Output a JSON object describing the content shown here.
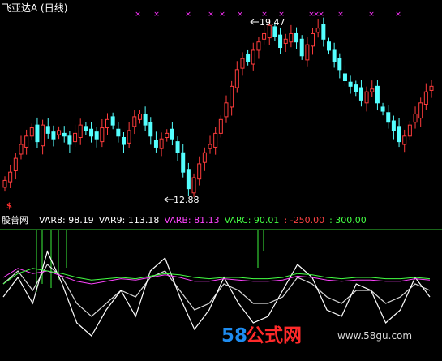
{
  "main_panel": {
    "title": "飞亚达A (日线)",
    "title_color": "#ffffff",
    "high_label": "19.47",
    "low_label": "12.88",
    "signal_glyph": "$",
    "signal_color": "#ff3030",
    "marker_glyph": "×",
    "marker_color": "#ff33ff",
    "up_color": "#ff3c3c",
    "down_color": "#54ffff"
  },
  "indicator_panel": {
    "name": "股善网",
    "readouts": [
      {
        "label": "VAR8: 98.19",
        "color": "#ffffff"
      },
      {
        "label": "VAR9: 113.18",
        "color": "#ffffff"
      },
      {
        "label": "VARB: 81.13",
        "color": "#ff44ff"
      },
      {
        "label": "VARC: 90.01",
        "color": "#44ff44"
      },
      {
        "label": ": -250.00",
        "color": "#ff4444"
      },
      {
        "label": ": 300.00",
        "color": "#44ff44"
      }
    ]
  },
  "watermark": {
    "number": "58",
    "name": "公式网",
    "url": "www.58gu.com"
  },
  "chart_data": [
    {
      "type": "candlestick",
      "title": "飞亚达A (日线)",
      "annotations": [
        "19.47",
        "12.88"
      ],
      "close_path": [
        13.6,
        13.9,
        14.4,
        14.9,
        15.2,
        15.5,
        15.0,
        15.6,
        15.3,
        15.1,
        15.4,
        15.2,
        14.9,
        15.3,
        15.6,
        15.4,
        15.2,
        15.1,
        15.5,
        15.8,
        15.6,
        15.2,
        14.9,
        15.4,
        15.9,
        16.0,
        15.6,
        15.2,
        14.8,
        15.1,
        15.3,
        15.1,
        14.6,
        13.9,
        13.3,
        13.7,
        14.2,
        14.6,
        14.9,
        15.3,
        15.8,
        16.4,
        17.0,
        17.6,
        18.0,
        17.9,
        18.3,
        18.6,
        18.9,
        19.2,
        18.8,
        18.4,
        18.7,
        18.9,
        18.6,
        18.1,
        18.5,
        18.9,
        19.1,
        18.7,
        18.3,
        17.9,
        17.6,
        17.2,
        17.0,
        16.8,
        16.5,
        16.8,
        16.9,
        16.4,
        16.1,
        15.7,
        15.4,
        15.0,
        15.2,
        15.6,
        16.0,
        16.4,
        16.8,
        17.0
      ]
    },
    {
      "type": "line",
      "series": [
        {
          "name": "VAR8",
          "color": "#ffffff",
          "values": [
            40,
            55,
            35,
            75,
            50,
            20,
            10,
            30,
            45,
            25,
            60,
            70,
            40,
            15,
            30,
            55,
            35,
            20,
            25,
            45,
            65,
            55,
            30,
            25,
            50,
            45,
            20,
            30,
            55,
            40
          ]
        },
        {
          "name": "VAR9",
          "color": "#ffffff",
          "values": [
            50,
            60,
            45,
            65,
            55,
            35,
            25,
            35,
            45,
            40,
            55,
            60,
            45,
            30,
            35,
            50,
            45,
            35,
            35,
            40,
            55,
            50,
            40,
            35,
            45,
            45,
            35,
            40,
            50,
            45
          ]
        },
        {
          "name": "VARB",
          "color": "#ff44ff",
          "values": [
            55,
            62,
            58,
            60,
            56,
            52,
            50,
            52,
            54,
            53,
            55,
            57,
            55,
            52,
            52,
            54,
            53,
            52,
            52,
            53,
            56,
            55,
            53,
            52,
            53,
            53,
            52,
            52,
            54,
            53
          ]
        },
        {
          "name": "VARC",
          "color": "#44ff44",
          "values": [
            50,
            58,
            62,
            60,
            58,
            55,
            53,
            54,
            55,
            54,
            56,
            58,
            57,
            55,
            54,
            55,
            55,
            54,
            54,
            55,
            58,
            57,
            55,
            54,
            55,
            55,
            54,
            54,
            55,
            54
          ]
        }
      ]
    }
  ]
}
